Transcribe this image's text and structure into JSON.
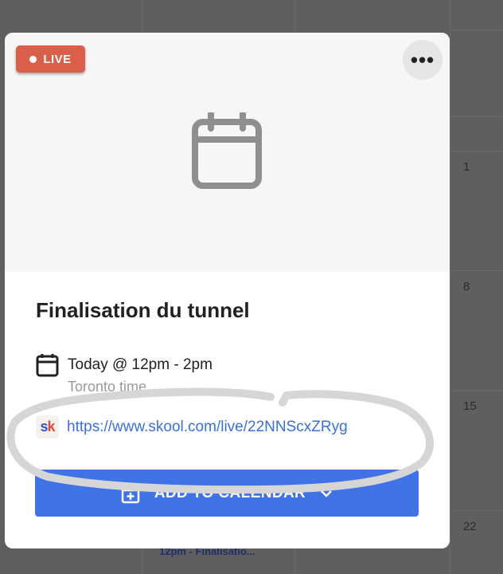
{
  "background": {
    "day_numbers": [
      "1",
      "8",
      "15",
      "22"
    ],
    "event_preview": "12pm - Finalisatio..."
  },
  "event": {
    "live_badge": "LIVE",
    "title": "Finalisation du tunnel",
    "date": "Today @ 12pm - 2pm",
    "timezone": "Toronto time",
    "link_logo": "sk",
    "link": "https://www.skool.com/live/22NNScxZRyg",
    "add_button": "ADD TO CALENDAR"
  },
  "icons": {
    "more": "more-options-icon",
    "hero": "calendar-icon",
    "date": "calendar-icon",
    "add": "calendar-add-icon",
    "dropdown": "chevron-down-icon"
  },
  "colors": {
    "live_badge": "#d95f4b",
    "button": "#3f73e6",
    "link": "#3a70d8",
    "overlay": "#5f5f5f"
  }
}
